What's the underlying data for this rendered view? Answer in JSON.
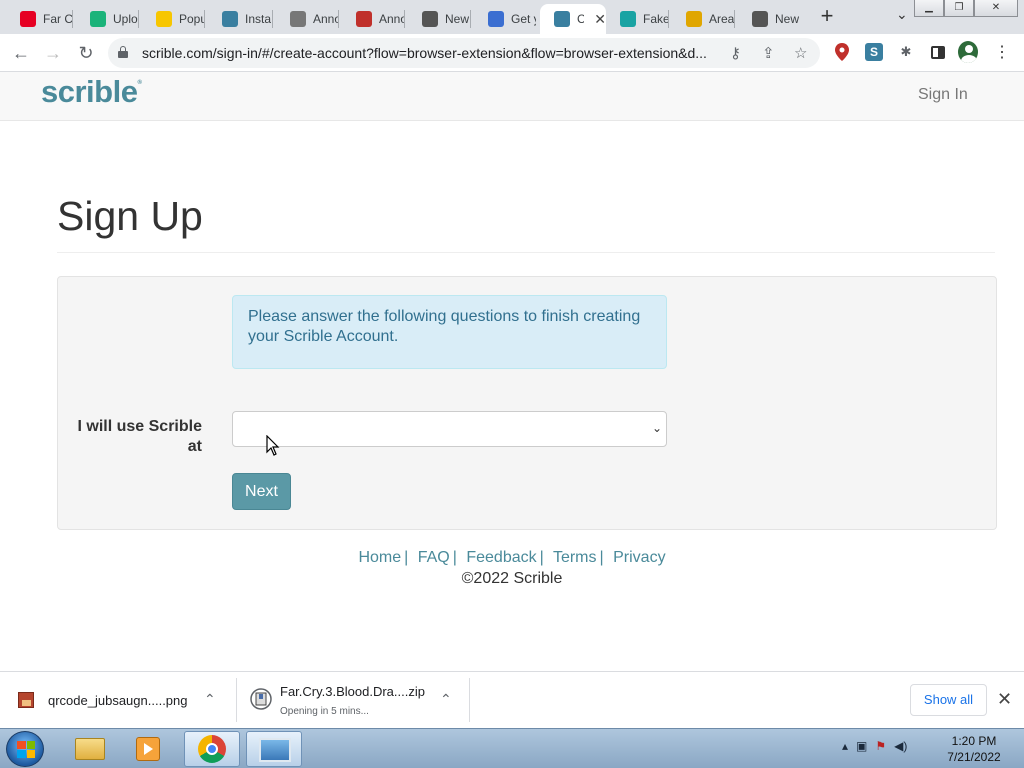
{
  "browser": {
    "tabs": [
      {
        "title": "Far C",
        "icon": "pinterest-icon",
        "color": "#e60023"
      },
      {
        "title": "Uplo",
        "icon": "upload-icon",
        "color": "#1bb37a"
      },
      {
        "title": "Popu",
        "icon": "popup-icon",
        "color": "#f7c600"
      },
      {
        "title": "Insta",
        "icon": "scrible-icon",
        "color": "#3a7fa0"
      },
      {
        "title": "Anno",
        "icon": "annotate-icon",
        "color": "#777"
      },
      {
        "title": "Anno",
        "icon": "map-pin-icon",
        "color": "#c0302b"
      },
      {
        "title": "New",
        "icon": "chrome-icon",
        "color": "#555"
      },
      {
        "title": "Get y",
        "icon": "app-icon",
        "color": "#3b6ed1"
      },
      {
        "title": "C",
        "icon": "scrible-icon",
        "color": "#3a7fa0",
        "active": true
      },
      {
        "title": "Fake",
        "icon": "contact-icon",
        "color": "#19a3a3"
      },
      {
        "title": "Area",
        "icon": "font-icon",
        "color": "#e0a600"
      },
      {
        "title": "New",
        "icon": "chrome-icon",
        "color": "#555"
      }
    ],
    "url": "scrible.com/sign-in/#/create-account?flow=browser-extension&flow=browser-extension&d..."
  },
  "site": {
    "logo": "scrible",
    "logo_mark": "®",
    "signin": "Sign In"
  },
  "page": {
    "title": "Sign Up",
    "alert": "Please answer the following questions to finish creating your Scrible Account.",
    "field_label": "I will use Scrible at",
    "select_value": "",
    "next": "Next"
  },
  "footer": {
    "links": [
      "Home",
      "FAQ",
      "Feedback",
      "Terms",
      "Privacy"
    ],
    "sep": "|",
    "copyright": "©2022 Scrible"
  },
  "downloads": {
    "items": [
      {
        "name": "qrcode_jubsaugn.....png",
        "status": ""
      },
      {
        "name": "Far.Cry.3.Blood.Dra....zip",
        "status": "Opening in 5 mins..."
      }
    ],
    "show_all": "Show all"
  },
  "taskbar": {
    "time": "1:20 PM",
    "date": "7/21/2022"
  }
}
